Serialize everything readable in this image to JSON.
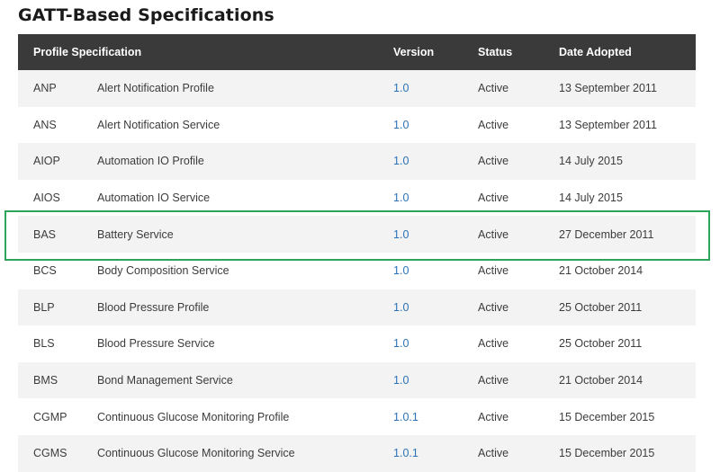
{
  "page": {
    "title": "GATT-Based Specifications"
  },
  "table": {
    "headers": {
      "profile": "Profile Specification",
      "version": "Version",
      "status": "Status",
      "date": "Date Adopted"
    },
    "rows": [
      {
        "abbr": "ANP",
        "name": "Alert Notification Profile",
        "version": "1.0",
        "status": "Active",
        "date": "13 September 2011"
      },
      {
        "abbr": "ANS",
        "name": "Alert Notification Service",
        "version": "1.0",
        "status": "Active",
        "date": "13 September 2011"
      },
      {
        "abbr": "AIOP",
        "name": "Automation IO Profile",
        "version": "1.0",
        "status": "Active",
        "date": "14 July 2015"
      },
      {
        "abbr": "AIOS",
        "name": "Automation IO Service",
        "version": "1.0",
        "status": "Active",
        "date": "14 July 2015"
      },
      {
        "abbr": "BAS",
        "name": "Battery Service",
        "version": "1.0",
        "status": "Active",
        "date": "27 December 2011"
      },
      {
        "abbr": "BCS",
        "name": "Body Composition Service",
        "version": "1.0",
        "status": "Active",
        "date": "21 October 2014"
      },
      {
        "abbr": "BLP",
        "name": "Blood Pressure Profile",
        "version": "1.0",
        "status": "Active",
        "date": "25 October 2011"
      },
      {
        "abbr": "BLS",
        "name": "Blood Pressure Service",
        "version": "1.0",
        "status": "Active",
        "date": "25 October 2011"
      },
      {
        "abbr": "BMS",
        "name": "Bond Management Service",
        "version": "1.0",
        "status": "Active",
        "date": "21 October 2014"
      },
      {
        "abbr": "CGMP",
        "name": "Continuous Glucose Monitoring Profile",
        "version": "1.0.1",
        "status": "Active",
        "date": "15 December 2015"
      },
      {
        "abbr": "CGMS",
        "name": "Continuous Glucose Monitoring Service",
        "version": "1.0.1",
        "status": "Active",
        "date": "15 December 2015"
      }
    ]
  },
  "colors": {
    "header_bg": "#3a3a3a",
    "row_alt_bg": "#f3f3f3",
    "link": "#2b72b8",
    "highlight": "#2ea35a"
  }
}
